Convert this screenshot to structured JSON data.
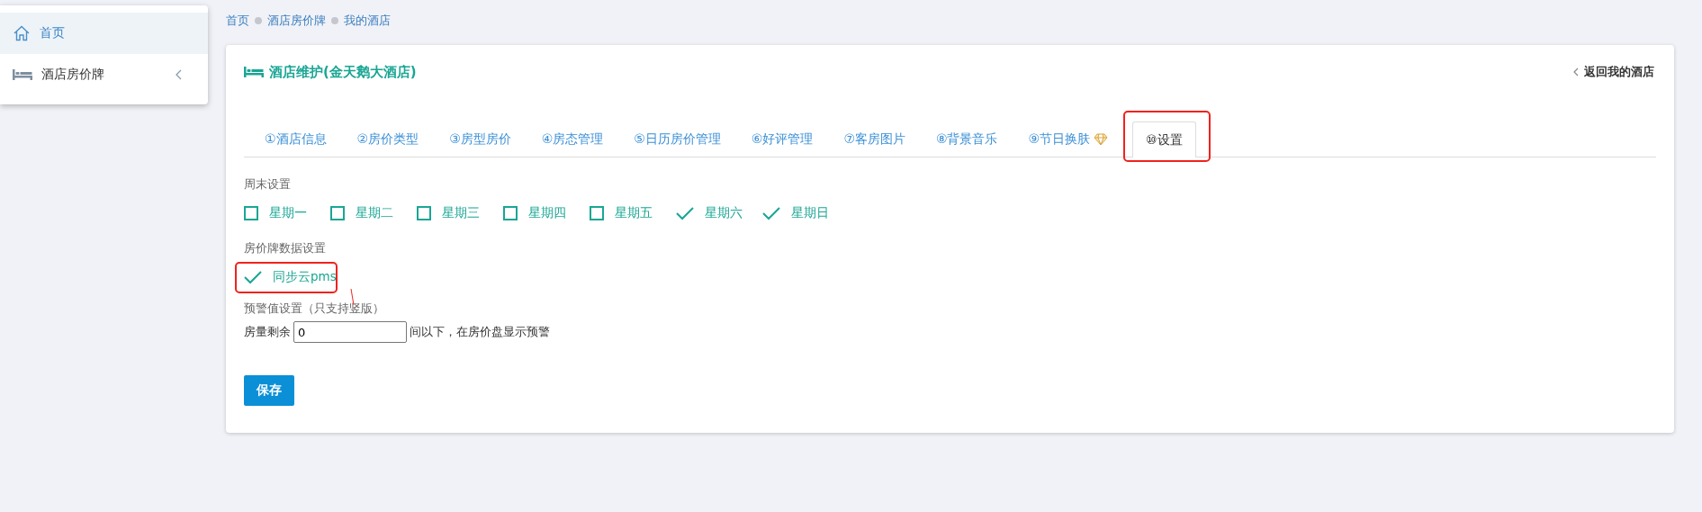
{
  "sidebar": {
    "items": [
      {
        "label": "首页",
        "kind": "home",
        "selected": true
      },
      {
        "label": "酒店房价牌",
        "kind": "bed",
        "selected": false,
        "expanded": false
      }
    ]
  },
  "breadcrumb": [
    "首页",
    "酒店房价牌",
    "我的酒店"
  ],
  "card": {
    "title": "酒店维护(金天鹅大酒店)",
    "back_link": "返回我的酒店"
  },
  "tabs": [
    {
      "label": "①酒店信息",
      "selected": false
    },
    {
      "label": "②房价类型",
      "selected": false
    },
    {
      "label": "③房型房价",
      "selected": false
    },
    {
      "label": "④房态管理",
      "selected": false
    },
    {
      "label": "⑤日历房价管理",
      "selected": false
    },
    {
      "label": "⑥好评管理",
      "selected": false
    },
    {
      "label": "⑦客房图片",
      "selected": false
    },
    {
      "label": "⑧背景音乐",
      "selected": false
    },
    {
      "label": "⑨节日换肤",
      "selected": false,
      "featured": true
    },
    {
      "label": "⑩设置",
      "selected": true,
      "annotated": true
    }
  ],
  "weekend": {
    "label": "周末设置",
    "options": [
      {
        "label": "星期一",
        "checked": false
      },
      {
        "label": "星期二",
        "checked": false
      },
      {
        "label": "星期三",
        "checked": false
      },
      {
        "label": "星期四",
        "checked": false
      },
      {
        "label": "星期五",
        "checked": false
      },
      {
        "label": "星期六",
        "checked": true
      },
      {
        "label": "星期日",
        "checked": true
      }
    ]
  },
  "data_settings": {
    "label": "房价牌数据设置",
    "options": [
      {
        "label": "同步云pms",
        "checked": true,
        "annotated": true
      }
    ]
  },
  "warning": {
    "label": "预警值设置（只支持竖版）",
    "prefix": "房量剩余",
    "value": "0",
    "suffix": "间以下，在房价盘显示预警"
  },
  "save_button": "保存"
}
